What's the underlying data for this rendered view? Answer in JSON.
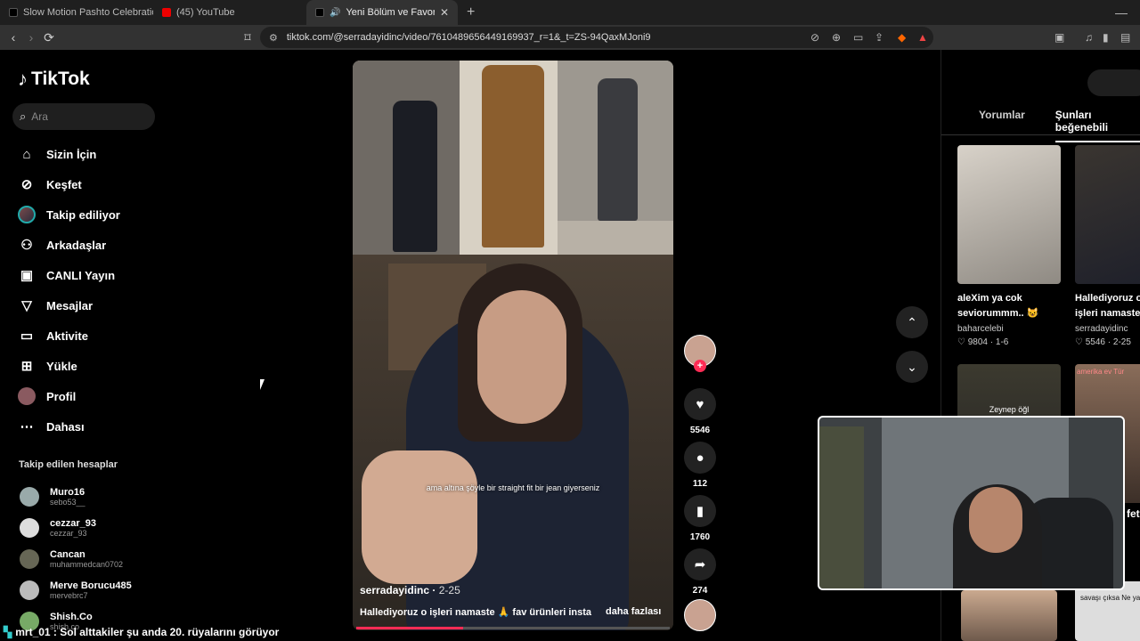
{
  "browser": {
    "tabs": [
      {
        "label": "Slow Motion Pashto Celebration Vid",
        "active": false
      },
      {
        "label": "(45) YouTube",
        "active": false
      },
      {
        "label": "Yeni Bölüm ve Favori Ürünler",
        "active": true
      }
    ],
    "url": "tiktok.com/@serradayidinc/video/7610489656449169937_r=1&_t=ZS-94QaxMJoni9"
  },
  "sidebar": {
    "logo": "TikTok",
    "search_placeholder": "Ara",
    "nav": [
      {
        "label": "Sizin İçin",
        "icon": "home-icon"
      },
      {
        "label": "Keşfet",
        "icon": "compass-icon"
      },
      {
        "label": "Takip ediliyor",
        "icon": "avatar"
      },
      {
        "label": "Arkadaşlar",
        "icon": "friends-icon"
      },
      {
        "label": "CANLI Yayın",
        "icon": "live-icon"
      },
      {
        "label": "Mesajlar",
        "icon": "send-icon"
      },
      {
        "label": "Aktivite",
        "icon": "activity-icon"
      },
      {
        "label": "Yükle",
        "icon": "upload-icon"
      },
      {
        "label": "Profil",
        "icon": "profile-avatar"
      },
      {
        "label": "Dahası",
        "icon": "more-icon"
      }
    ],
    "following_title": "Takip edilen hesaplar",
    "following": [
      {
        "name": "Muro16",
        "handle": "sebo53__"
      },
      {
        "name": "cezzar_93",
        "handle": "cezzar_93"
      },
      {
        "name": "Cancan",
        "handle": "muhammedcan0702"
      },
      {
        "name": "Merve Borucu485",
        "handle": "mervebrc7"
      },
      {
        "name": "Shish.Co",
        "handle": "shish.co"
      }
    ]
  },
  "video": {
    "caption": "ama altına şöyle bir straight fit bir jean giyerseniz",
    "author": "serradayidinc",
    "date": "2-25",
    "description": "Hallediyoruz o işleri namaste 🙏 fav ürünleri insta",
    "more": "daha fazlası",
    "progress": 0.34
  },
  "actions": {
    "likes": "5546",
    "comments": "112",
    "saves": "1760",
    "shares": "274"
  },
  "right_panel": {
    "tabs": [
      "Yorumlar",
      "Şunları beğenebili"
    ],
    "cards": [
      {
        "title1": "aleXim ya cok",
        "title2": "seviorummm.. 😺",
        "author": "baharcelebi",
        "likes": "9804",
        "date": "1-6"
      },
      {
        "title1": "Hallediyoruz o",
        "title2": "işleri namaste",
        "author": "serradayidinc",
        "likes": "5546",
        "date": "2-25"
      }
    ],
    "thumb_texts": [
      "Zeynep öğl",
      "amerika ev Tür",
      "savaşı çıksa Ne ya",
      "fet"
    ]
  },
  "overlay": {
    "chat_line": "mrt_01 : Sol alttakiler şu anda 20. rüyalarını görüyor"
  }
}
